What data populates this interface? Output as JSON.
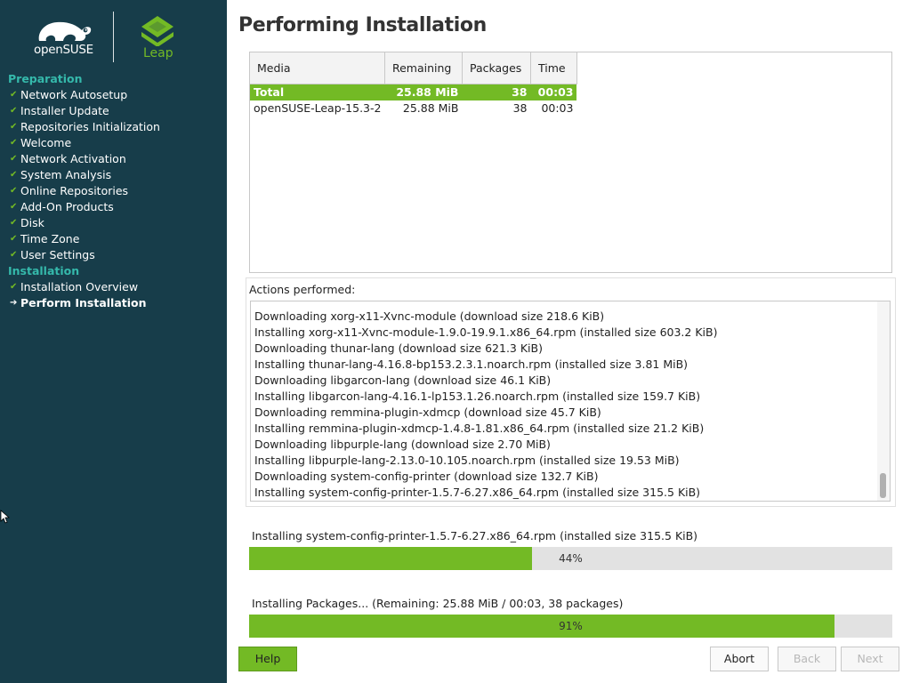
{
  "sidebar": {
    "brand": "openSUSE",
    "product": "Leap",
    "sections": [
      {
        "title": "Preparation",
        "steps": [
          {
            "label": "Network Autosetup",
            "state": "done"
          },
          {
            "label": "Installer Update",
            "state": "done"
          },
          {
            "label": "Repositories Initialization",
            "state": "done"
          },
          {
            "label": "Welcome",
            "state": "done"
          },
          {
            "label": "Network Activation",
            "state": "done"
          },
          {
            "label": "System Analysis",
            "state": "done"
          },
          {
            "label": "Online Repositories",
            "state": "done"
          },
          {
            "label": "Add-On Products",
            "state": "done"
          },
          {
            "label": "Disk",
            "state": "done"
          },
          {
            "label": "Time Zone",
            "state": "done"
          },
          {
            "label": "User Settings",
            "state": "done"
          }
        ]
      },
      {
        "title": "Installation",
        "steps": [
          {
            "label": "Installation Overview",
            "state": "done"
          },
          {
            "label": "Perform Installation",
            "state": "current"
          }
        ]
      }
    ],
    "icons": {
      "done": "check-icon",
      "current": "arrow-right-icon"
    }
  },
  "main": {
    "title": "Performing Installation",
    "media_table": {
      "columns": [
        "Media",
        "Remaining",
        "Packages",
        "Time"
      ],
      "rows": [
        {
          "media": "Total",
          "remaining": "25.88 MiB",
          "packages": "38",
          "time": "00:03",
          "selected": true
        },
        {
          "media": "openSUSE-Leap-15.3-2",
          "remaining": "25.88 MiB",
          "packages": "38",
          "time": "00:03",
          "selected": false
        }
      ]
    },
    "actions": {
      "label": "Actions performed:",
      "lines": [
        "Downloading xorg-x11-Xvnc-module (download size 218.6 KiB)",
        "Installing xorg-x11-Xvnc-module-1.9.0-19.9.1.x86_64.rpm (installed size 603.2 KiB)",
        "Downloading thunar-lang (download size 621.3 KiB)",
        "Installing thunar-lang-4.16.8-bp153.2.3.1.noarch.rpm (installed size 3.81 MiB)",
        "Downloading libgarcon-lang (download size 46.1 KiB)",
        "Installing libgarcon-lang-4.16.1-lp153.1.26.noarch.rpm (installed size 159.7 KiB)",
        "Downloading remmina-plugin-xdmcp (download size 45.7 KiB)",
        "Installing remmina-plugin-xdmcp-1.4.8-1.81.x86_64.rpm (installed size 21.2 KiB)",
        "Downloading libpurple-lang (download size 2.70 MiB)",
        "Installing libpurple-lang-2.13.0-10.105.noarch.rpm (installed size 19.53 MiB)",
        "Downloading system-config-printer (download size 132.7 KiB)",
        "Installing system-config-printer-1.5.7-6.27.x86_64.rpm (installed size 315.5 KiB)"
      ]
    },
    "package_progress": {
      "label": "Installing system-config-printer-1.5.7-6.27.x86_64.rpm (installed size 315.5 KiB)",
      "percent": 44,
      "text": "44%"
    },
    "total_progress": {
      "label": "Installing Packages... (Remaining: 25.88 MiB / 00:03, 38 packages)",
      "percent": 91,
      "text": "91%"
    }
  },
  "buttons": {
    "help": "Help",
    "abort": "Abort",
    "back": "Back",
    "next": "Next"
  },
  "colors": {
    "sidebar_bg": "#173d4a",
    "accent_green": "#73ba25",
    "section_teal": "#35b9ab"
  }
}
